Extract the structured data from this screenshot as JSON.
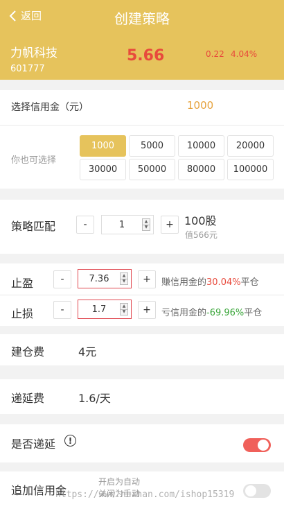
{
  "header": {
    "back_label": "返回",
    "title": "创建策略",
    "stock_name": "力帆科技",
    "stock_code": "601777",
    "price": "5.66",
    "change": "0.22",
    "change_pct": "4.04%"
  },
  "credit": {
    "label": "选择信用金（元）",
    "value": "1000",
    "alt_label": "你也可选择",
    "options": [
      "1000",
      "5000",
      "10000",
      "20000",
      "30000",
      "50000",
      "80000",
      "100000"
    ],
    "selected": "1000"
  },
  "strategy": {
    "label": "策略匹配",
    "minus": "-",
    "plus": "+",
    "qty": "1",
    "shares": "100股",
    "worth": "值566元"
  },
  "take_profit": {
    "label": "止盈",
    "minus": "-",
    "plus": "+",
    "value": "7.36",
    "note_prefix": "赚信用金的",
    "note_pct": "30.04%",
    "note_suffix": "平仓"
  },
  "stop_loss": {
    "label": "止损",
    "minus": "-",
    "plus": "+",
    "value": "1.7",
    "note_prefix": "亏信用金的",
    "note_pct": "-69.96%",
    "note_suffix": "平仓"
  },
  "fees": {
    "build_label": "建仓费",
    "build_value": "4元",
    "defer_label": "递延费",
    "defer_value": "1.6/天"
  },
  "defer_toggle": {
    "label": "是否递延",
    "info": "!",
    "on": true
  },
  "add_credit": {
    "label": "追加信用金",
    "hint_line1": "开启为自动",
    "hint_line2": "关闭为手动",
    "on": false
  },
  "watermark": "https://www.huzhan.com/ishop15319",
  "colors": {
    "accent": "#e6c35c",
    "up": "#e84a3c",
    "down": "#3aa63a",
    "toggle_on": "#f0605a"
  }
}
